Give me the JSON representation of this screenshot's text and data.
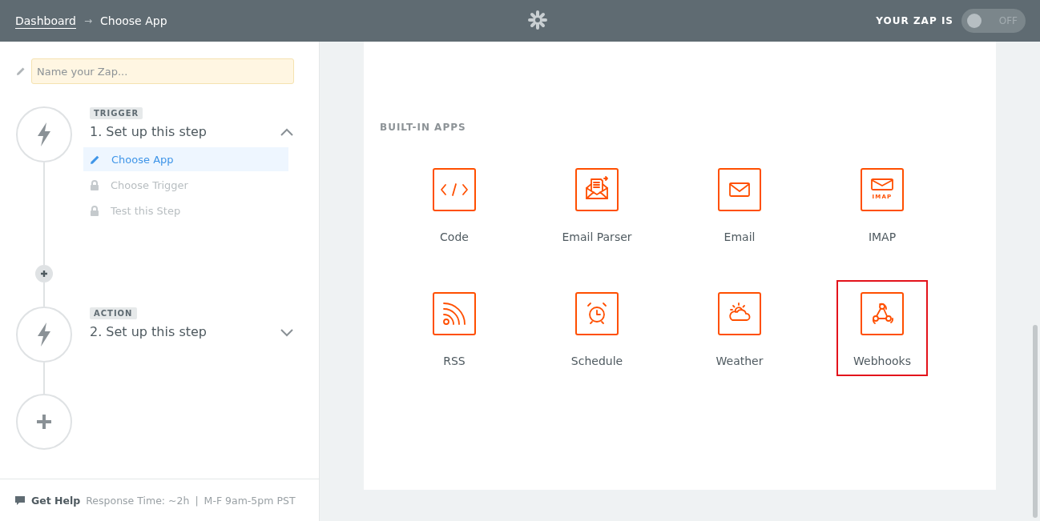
{
  "header": {
    "breadcrumb": [
      {
        "label": "Dashboard",
        "link": true
      },
      {
        "label": "Choose App",
        "link": false
      }
    ],
    "separator": "→",
    "zap_status_label": "YOUR ZAP IS",
    "toggle": {
      "on": false,
      "label": "OFF"
    }
  },
  "sidebar": {
    "name_field": {
      "placeholder": "Name your Zap..."
    },
    "steps": [
      {
        "badge": "TRIGGER",
        "title": "1. Set up this step",
        "expanded": true,
        "substeps": [
          {
            "label": "Choose App",
            "selected": true,
            "locked": false
          },
          {
            "label": "Choose Trigger",
            "selected": false,
            "locked": true
          },
          {
            "label": "Test this Step",
            "selected": false,
            "locked": true
          }
        ]
      },
      {
        "badge": "ACTION",
        "title": "2. Set up this step",
        "expanded": false
      }
    ],
    "footer": {
      "help_label": "Get Help",
      "response_text": "Response Time: ~2h",
      "divider": "|",
      "hours": "M-F 9am-5pm PST"
    }
  },
  "main": {
    "section_title": "BUILT-IN APPS",
    "apps": [
      {
        "name": "Code",
        "kind": "code",
        "selected": false
      },
      {
        "name": "Email Parser",
        "kind": "parser",
        "selected": false
      },
      {
        "name": "Email",
        "kind": "email",
        "selected": false
      },
      {
        "name": "IMAP",
        "kind": "imap",
        "icon_text": "IMAP",
        "selected": false
      },
      {
        "name": "RSS",
        "kind": "rss",
        "selected": false
      },
      {
        "name": "Schedule",
        "kind": "schedule",
        "selected": false
      },
      {
        "name": "Weather",
        "kind": "weather",
        "selected": false
      },
      {
        "name": "Webhooks",
        "kind": "webhooks",
        "selected": true
      }
    ]
  }
}
